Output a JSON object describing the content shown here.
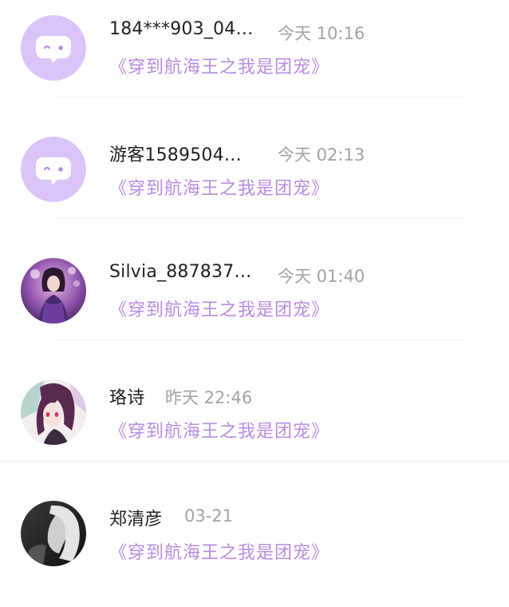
{
  "comments": [
    {
      "name": "184***903_04…",
      "time": "今天 10:16",
      "book": "《穿到航海王之我是团宠》",
      "avatar_icon": "default-chat-bubble-avatar"
    },
    {
      "name": "游客1589504…",
      "time": "今天 02:13",
      "book": "《穿到航海王之我是团宠》",
      "avatar_icon": "default-chat-bubble-avatar"
    },
    {
      "name": "Silvia_887837…",
      "time": "今天 01:40",
      "book": "《穿到航海王之我是团宠》",
      "avatar_icon": "anime-girl-avatar"
    },
    {
      "name": "珞诗",
      "time": "昨天 22:46",
      "book": "《穿到航海王之我是团宠》",
      "avatar_icon": "anime-girl-avatar"
    },
    {
      "name": "郑清彦",
      "time": "03-21",
      "book": "《穿到航海王之我是团宠》",
      "avatar_icon": "grayscale-photo-avatar"
    }
  ],
  "colors": {
    "accent_purple": "#b98be2",
    "default_avatar_bg": "#d9c5f7",
    "name_text": "#222222",
    "time_text": "#a3a3a3",
    "divider": "#efefef"
  }
}
